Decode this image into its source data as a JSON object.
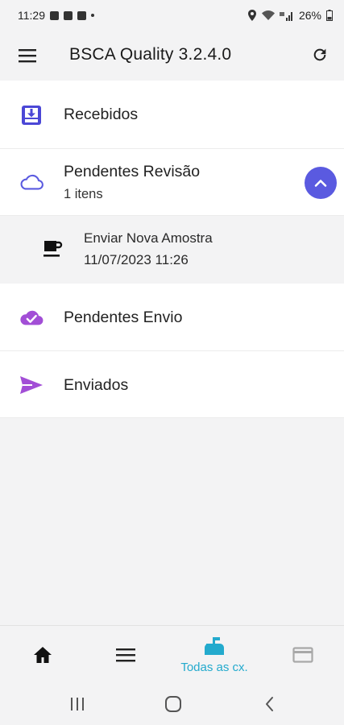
{
  "status_bar": {
    "time": "11:29",
    "battery": "26%"
  },
  "app_bar": {
    "title": "BSCA Quality 3.2.4.0"
  },
  "list": {
    "items": [
      {
        "label": "Recebidos",
        "icon": "inbox-download-icon"
      },
      {
        "label": "Pendentes Revisão",
        "sublabel": "1 itens",
        "icon": "cloud-outline-icon",
        "expanded": true
      },
      {
        "label": "Pendentes Envio",
        "icon": "cloud-check-icon"
      },
      {
        "label": "Enviados",
        "icon": "send-icon"
      }
    ],
    "sub_items": [
      {
        "title": "Enviar Nova Amostra",
        "datetime": "11/07/2023 11:26",
        "icon": "coffee-cup-icon"
      }
    ]
  },
  "bottom_nav": {
    "items": [
      {
        "icon": "home-icon",
        "label": ""
      },
      {
        "icon": "list-icon",
        "label": ""
      },
      {
        "icon": "mailbox-icon",
        "label": "Todas as cx.",
        "active": true
      },
      {
        "icon": "card-icon",
        "label": ""
      }
    ]
  },
  "colors": {
    "accent": "#5a5ae0",
    "purple": "#a24ed6",
    "active_nav": "#23aacd",
    "background": "#f3f3f4"
  }
}
